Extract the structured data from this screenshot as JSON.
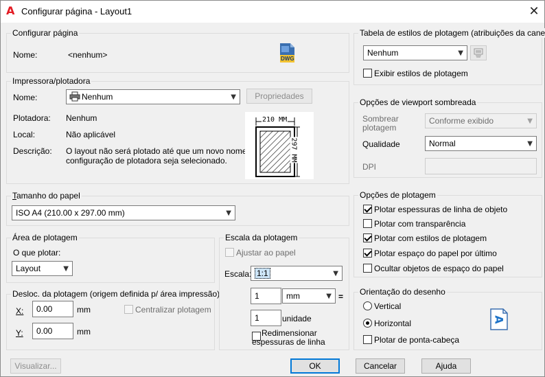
{
  "window": {
    "title": "Configurar página - Layout1"
  },
  "page_setup": {
    "title": "Configurar página",
    "name_label": "Nome:",
    "name_value": "<nenhum>",
    "dwg_icon_text": "DWG"
  },
  "printer": {
    "title": "Impressora/plotadora",
    "name_label": "Nome:",
    "name_value": "Nenhum",
    "properties_button": "Propriedades",
    "plotter_label": "Plotadora:",
    "plotter_value": "Nenhum",
    "location_label": "Local:",
    "location_value": "Não aplicável",
    "description_label": "Descrição:",
    "description_line1": "O layout não será plotado até que um novo nome de",
    "description_line2": "configuração de plotadora seja selecionado.",
    "preview_width_label": "210 MM",
    "preview_height_label": "297 MM"
  },
  "paper_size": {
    "title": "Tamanho do papel",
    "value": "ISO A4 (210.00 x 297.00 mm)"
  },
  "plot_area": {
    "title": "Área de plotagem",
    "what_label": "O que plotar:",
    "what_value": "Layout"
  },
  "plot_offset": {
    "title": "Desloc. da plotagem (origem definida p/ área impressão)",
    "x_label": "X:",
    "x_value": "0.00",
    "x_unit": "mm",
    "y_label": "Y:",
    "y_value": "0.00",
    "y_unit": "mm",
    "center_label": "Centralizar plotagem"
  },
  "plot_scale": {
    "title": "Escala da plotagem",
    "fit_label": "Ajustar ao papel",
    "scale_label": "Escala:",
    "scale_value": "1:1",
    "top_value": "1",
    "unit_value": "mm",
    "equals": "=",
    "bottom_value": "1",
    "bottom_unit": "unidade",
    "scale_lineweights_line1": "Redimensionar",
    "scale_lineweights_line2": "espessuras de linha"
  },
  "plot_style_table": {
    "title": "Tabela de estilos de plotagem (atribuições da caneta)",
    "value": "Nenhum",
    "display_label": "Exibir estilos de plotagem"
  },
  "shaded_viewport": {
    "title": "Opções de viewport sombreada",
    "shade_plot_label_line1": "Sombrear",
    "shade_plot_label_line2": "plotagem",
    "shade_plot_value": "Conforme exibido",
    "quality_label": "Qualidade",
    "quality_value": "Normal",
    "dpi_label": "DPI"
  },
  "plot_options": {
    "title": "Opções de plotagem",
    "items": [
      {
        "label": "Plotar espessuras de linha de objeto",
        "checked": true
      },
      {
        "label": "Plotar com transparência",
        "checked": false
      },
      {
        "label": "Plotar com estilos de plotagem",
        "checked": true
      },
      {
        "label": "Plotar espaço do papel por último",
        "checked": true
      },
      {
        "label": "Ocultar objetos de espaço do papel",
        "checked": false
      }
    ]
  },
  "orientation": {
    "title": "Orientação do desenho",
    "portrait": "Vertical",
    "landscape": "Horizontal",
    "selected": "Horizontal",
    "upside_down": "Plotar de ponta-cabeça",
    "icon_glyph": "A"
  },
  "footer": {
    "preview": "Visualizar...",
    "ok": "OK",
    "cancel": "Cancelar",
    "help": "Ajuda"
  }
}
